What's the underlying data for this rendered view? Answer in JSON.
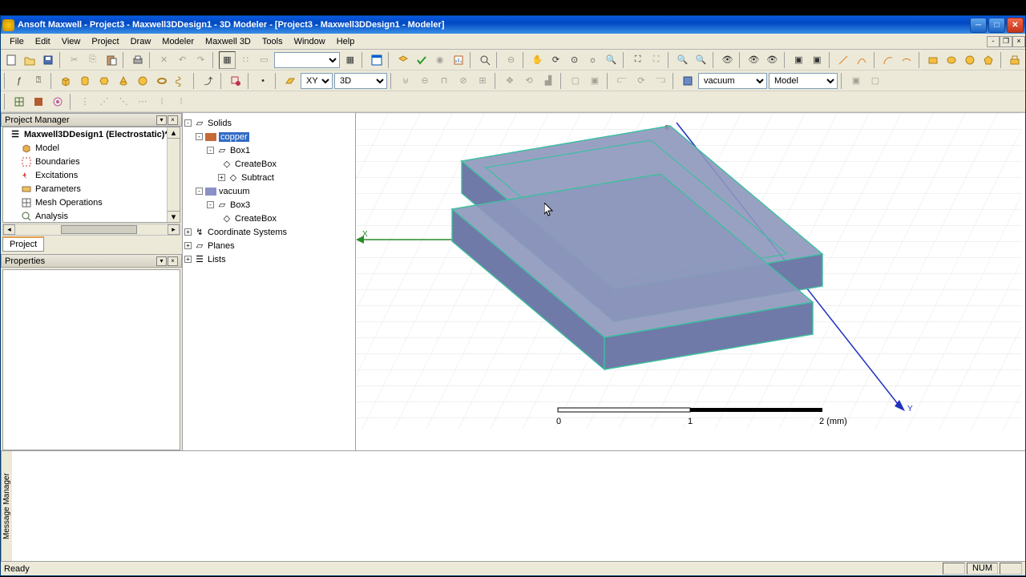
{
  "title": "Ansoft Maxwell - Project3 - Maxwell3DDesign1 - 3D Modeler - [Project3 - Maxwell3DDesign1 - Modeler]",
  "menu": [
    "File",
    "Edit",
    "View",
    "Project",
    "Draw",
    "Modeler",
    "Maxwell 3D",
    "Tools",
    "Window",
    "Help"
  ],
  "plane_sel": "XY",
  "mode_sel": "3D",
  "material_sel": "vacuum",
  "view_sel": "Model",
  "pm": {
    "title": "Project Manager",
    "design": "Maxwell3DDesign1 (Electrostatic)*",
    "items": [
      "Model",
      "Boundaries",
      "Excitations",
      "Parameters",
      "Mesh Operations",
      "Analysis"
    ],
    "tab": "Project"
  },
  "props_title": "Properties",
  "outline": {
    "root": "Solids",
    "mat1": "copper",
    "mat1_box": "Box1",
    "mat1_ops": [
      "CreateBox",
      "Subtract"
    ],
    "mat2": "vacuum",
    "mat2_box": "Box3",
    "mat2_ops": [
      "CreateBox"
    ],
    "coords": "Coordinate Systems",
    "planes": "Planes",
    "lists": "Lists"
  },
  "ruler": {
    "v0": "0",
    "v1": "1",
    "v2": "2 (mm)"
  },
  "axes": {
    "x": "X",
    "y": "Y"
  },
  "msg_title": "Message Manager",
  "status": "Ready",
  "num": "NUM"
}
